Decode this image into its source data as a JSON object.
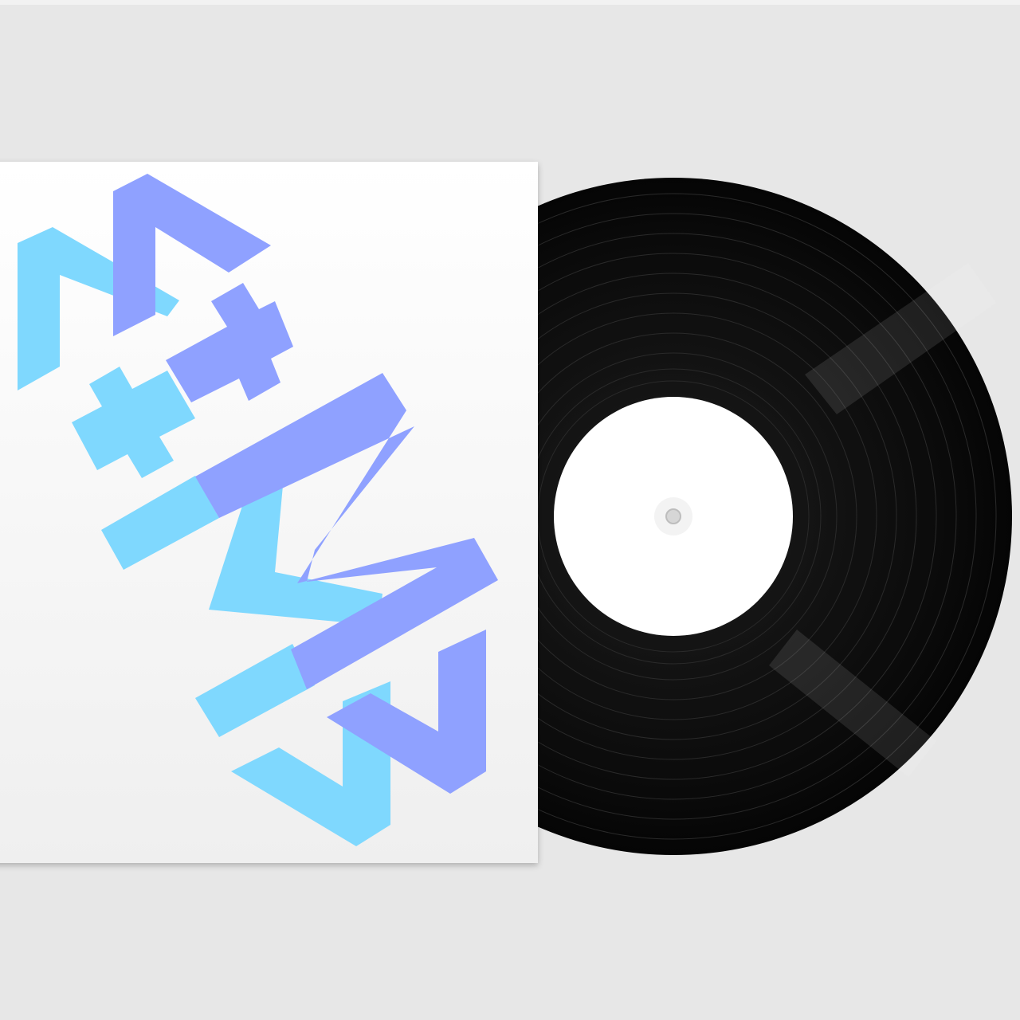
{
  "scene": {
    "background_color": "#e6e6e6",
    "sleeve_color": "#ffffff",
    "vinyl_color": "#0b0b0b",
    "label_color": "#ffffff",
    "spindle_hole_color": "#d6d6d6"
  },
  "artwork": {
    "icon": "abstract-geometric-logo",
    "colors": {
      "light_blue": "#7fd8fe",
      "periwinkle": "#8fa1ff"
    }
  }
}
